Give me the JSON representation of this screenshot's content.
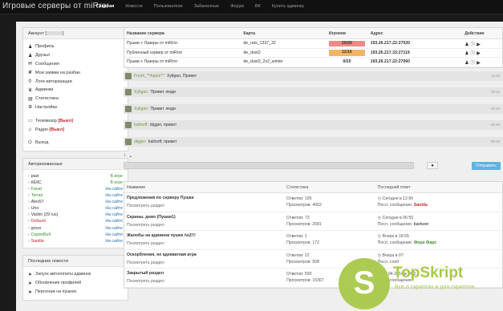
{
  "site_title": "Игровые серверы от miRror",
  "nav": [
    {
      "label": "Главная",
      "active": true
    },
    {
      "label": "Новости",
      "active": false
    },
    {
      "label": "Пользователи",
      "active": false
    },
    {
      "label": "Забаненные",
      "active": false
    },
    {
      "label": "Форум",
      "active": false
    },
    {
      "label": "ВК",
      "active": false
    },
    {
      "label": "Купить админку",
      "active": false
    }
  ],
  "account": {
    "title": "Аккаунт [",
    "title_suffix": "]",
    "menu": [
      {
        "icon": "user-icon",
        "label": "Профиль"
      },
      {
        "icon": "users-icon",
        "label": "Друзья"
      },
      {
        "icon": "envelope-icon",
        "label": "Сообщения"
      },
      {
        "icon": "ban-icon",
        "label": "Мои заявки на разбан"
      },
      {
        "icon": "location-icon",
        "label": "Логи авторизации"
      },
      {
        "icon": "admins-icon",
        "label": "Админки"
      },
      {
        "icon": "stats-icon",
        "label": "Статистика"
      },
      {
        "icon": "gear-icon",
        "label": "Настройки"
      }
    ],
    "tv_label": "Телевизор",
    "tv_value": "[Выкл]",
    "radio_label": "Радио",
    "radio_value": "[Выкл]",
    "logout_label": "Выход"
  },
  "authorized": {
    "title": "Авторизованные",
    "users": [
      {
        "name": "past",
        "status": "В игре",
        "kind": "game",
        "color": "default"
      },
      {
        "name": "КЕКС",
        "status": "В игре",
        "kind": "game",
        "color": "default"
      },
      {
        "name": "Fanat",
        "status": "На сайте",
        "kind": "site",
        "color": "green"
      },
      {
        "name": "Terran",
        "status": "На сайте",
        "kind": "site",
        "color": "green"
      },
      {
        "name": "Alex57",
        "status": "На сайте",
        "kind": "site",
        "color": "default"
      },
      {
        "name": "Uno",
        "status": "На сайте",
        "kind": "site",
        "color": "default"
      },
      {
        "name": "Vadim }29 rus{",
        "status": "На сайте",
        "kind": "site",
        "color": "default"
      },
      {
        "name": "Defaunt",
        "status": "На сайте",
        "kind": "site",
        "color": "red"
      },
      {
        "name": "gross",
        "status": "На сайте",
        "kind": "site",
        "color": "default"
      },
      {
        "name": "CepeeBu4",
        "status": "На сайте",
        "kind": "site",
        "color": "green"
      },
      {
        "name": "Santila",
        "status": "На сайте",
        "kind": "site",
        "color": "red"
      }
    ]
  },
  "news": {
    "title": "Последние новости",
    "items": [
      "Запуск автооплаты админок",
      "Обновление профилей",
      "Персонаж на пушках"
    ]
  },
  "servers": {
    "headers": {
      "name": "Название сервера",
      "map": "Карта",
      "players": "Игроков",
      "addr": "Адрес",
      "actions": "Действие"
    },
    "rows": [
      {
        "name": "Пушки + Лазеры от miRror",
        "map": "de_rats_1337_32",
        "players": "20/20",
        "fill": "full",
        "addr": "193.26.217.22:27520"
      },
      {
        "name": "Публичный сервер от miRror",
        "map": "de_dust2",
        "players": "11/16",
        "fill": "partial",
        "addr": "193.26.217.33:27119"
      },
      {
        "name": "Пушки + Лазеры от miRror",
        "map": "de_dust2_2x2_winter",
        "players": "0/20",
        "fill": "empty",
        "addr": "193.26.217.22:27060"
      }
    ]
  },
  "chat": {
    "messages": [
      {
        "nick": "Fresh_**Apple**:",
        "text": "Xyligan, Привет",
        "time": "11:04"
      },
      {
        "nick": "Xyligan:",
        "text": "Привет люди",
        "time": "09:11"
      },
      {
        "nick": "Xyligan:",
        "text": "Привет люди",
        "time": "09:10"
      },
      {
        "nick": "kalinoff:",
        "text": "digger, привет",
        "time": "08:46"
      },
      {
        "nick": "digger:",
        "text": "kalinoff, привет",
        "time": "08:46"
      }
    ],
    "send_label": "Отправить"
  },
  "forum": {
    "headers": {
      "name": "Название",
      "stats": "Статистика",
      "last": "Последний ответ"
    },
    "rows": [
      {
        "title": "Предложения по серверу Пушки",
        "sub": "Посмотреть раздел",
        "answers": "Ответов: 195",
        "views": "Просмотров: 4002",
        "date": "Сегодня в 12:56",
        "last": "Посл. сообщение:",
        "author": "Santila",
        "author_color": "red"
      },
      {
        "title": "Скрины, демо (Пушки1)",
        "sub": "Посмотреть раздел",
        "answers": "Ответов: 73",
        "views": "Просмотров: 2581",
        "date": "Сегодня в 06:55",
        "last": "Посл. сообщение:",
        "author": "karlson",
        "author_color": "default"
      },
      {
        "title": "Жалобы на админов пушек №2!!!",
        "sub": "Посмотреть раздел",
        "answers": "Ответов: 1",
        "views": "Просмотров: 172",
        "date": "Вчера в 18:55",
        "last": "Посл. сообщение:",
        "author": "Фора Фарс",
        "author_color": "green"
      },
      {
        "title": "Оскорбления, не адекватная игра",
        "sub": "Посмотреть раздел",
        "answers": "Ответов: 22",
        "views": "Просмотров: 508",
        "date": "Вчера в 07:",
        "last": "Посл. сооб",
        "author": "",
        "author_color": "default"
      },
      {
        "title": "Закрытый раздел",
        "sub": "Посмотреть раздел",
        "answers": "Ответов: 593",
        "views": "Просмотров: 15367",
        "date": "07.04.2014 в 06:2",
        "last": "Посл. сообщение:",
        "author": "",
        "author_color": "default"
      }
    ]
  },
  "watermark": {
    "letter": "S",
    "name": "TopSkript",
    "tagline": "Все о скриптах и для скриптов..."
  }
}
